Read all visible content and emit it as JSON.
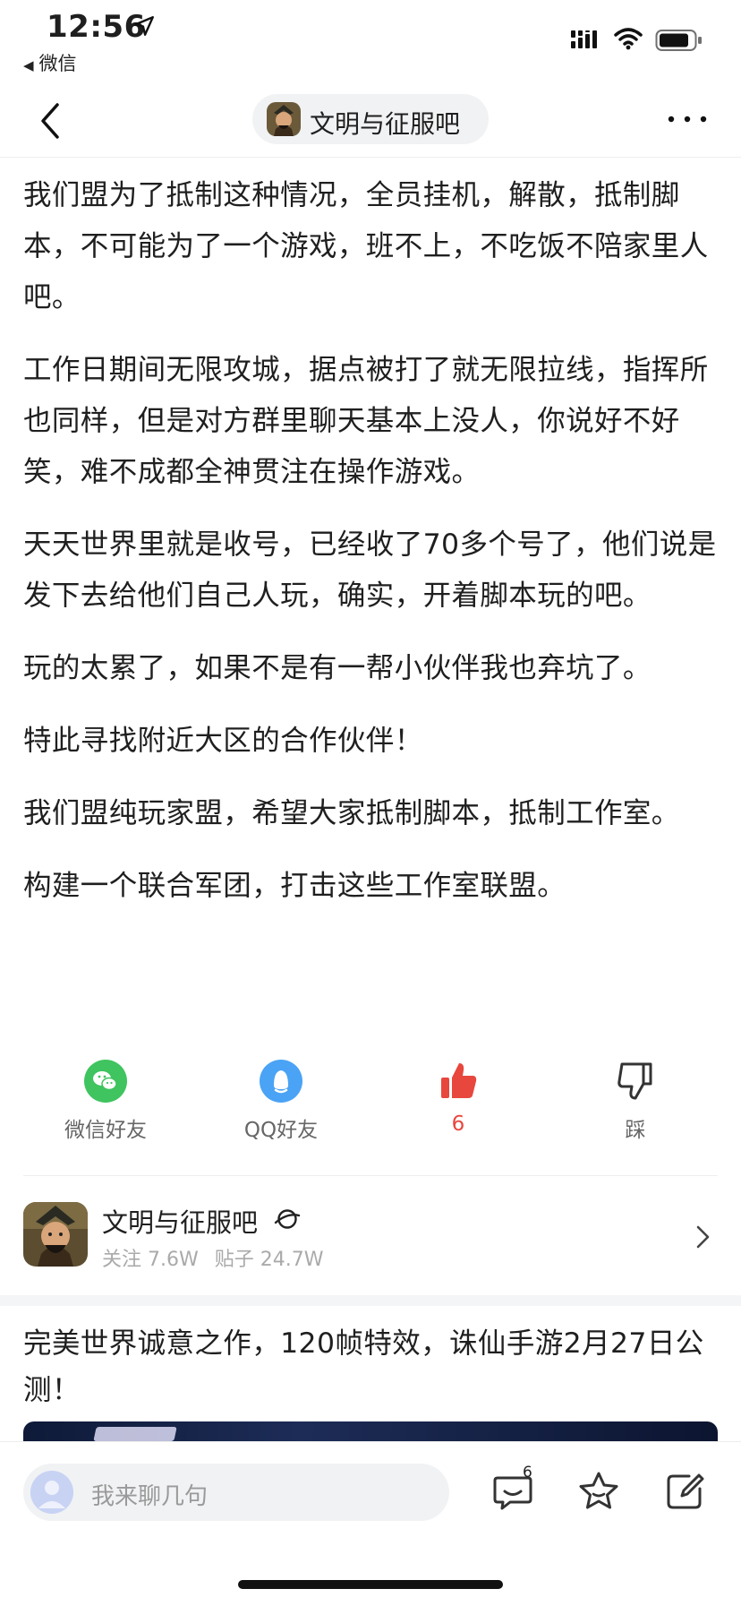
{
  "status_bar": {
    "time": "12:56",
    "back_app": "微信"
  },
  "nav": {
    "forum_name": "文明与征服吧"
  },
  "article": {
    "paragraphs": [
      "我们盟为了抵制这种情况，全员挂机，解散，抵制脚本，不可能为了一个游戏，班不上，不吃饭不陪家里人吧。",
      "工作日期间无限攻城，据点被打了就无限拉线，指挥所也同样，但是对方群里聊天基本上没人，你说好不好笑，难不成都全神贯注在操作游戏。",
      "天天世界里就是收号，已经收了70多个号了，他们说是发下去给他们自己人玩，确实，开着脚本玩的吧。",
      "玩的太累了，如果不是有一帮小伙伴我也弃坑了。",
      "特此寻找附近大区的合作伙伴！",
      "我们盟纯玩家盟，希望大家抵制脚本，抵制工作室。",
      "构建一个联合军团，打击这些工作室联盟。"
    ]
  },
  "actions": {
    "wechat_label": "微信好友",
    "qq_label": "QQ好友",
    "like_count": "6",
    "dislike_label": "踩",
    "colors": {
      "wechat": "#3fc45f",
      "qq": "#4aa3f5",
      "like": "#e8473d"
    }
  },
  "forum_card": {
    "name": "文明与征服吧",
    "follow": "关注 7.6W",
    "posts": "贴子 24.7W"
  },
  "next_post": {
    "title": "完美世界诚意之作，120帧特效，诛仙手游2月27日公测！"
  },
  "bottom_bar": {
    "input_placeholder": "我来聊几句",
    "comment_count": "6"
  },
  "icons": [
    "location-arrow-icon",
    "signal-icon",
    "wifi-icon",
    "battery-icon",
    "back-chevron-icon",
    "more-dots-icon",
    "wechat-icon",
    "qq-icon",
    "thumbs-up-icon",
    "thumbs-down-icon",
    "planet-icon",
    "chevron-right-icon",
    "comment-icon",
    "star-icon",
    "edit-icon"
  ]
}
